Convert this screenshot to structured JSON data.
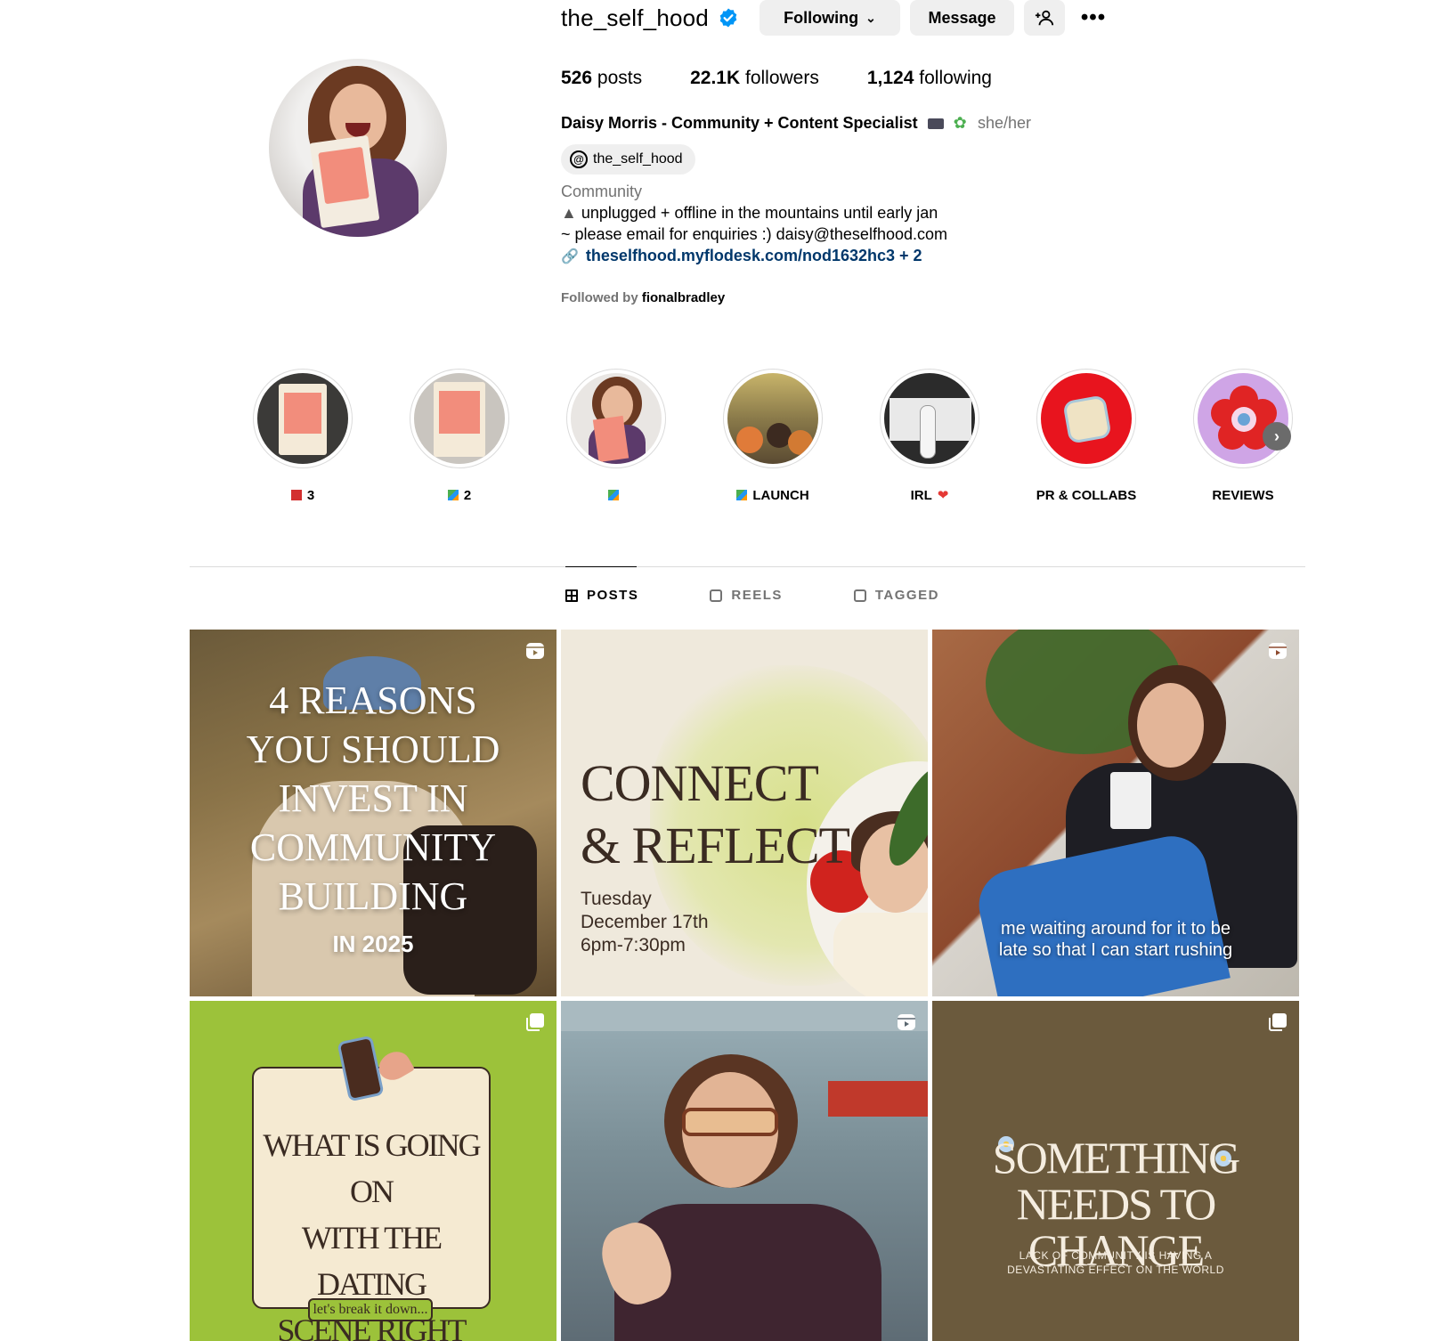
{
  "profile": {
    "username": "the_self_hood",
    "following_label": "Following",
    "message_label": "Message",
    "more_label": "•••",
    "stats": {
      "posts_count": "526",
      "posts_label": "posts",
      "followers_count": "22.1K",
      "followers_label": "followers",
      "following_count": "1,124",
      "following_label": "following"
    },
    "full_name": "Daisy Morris - Community + Content Specialist",
    "pronouns": "she/her",
    "threads_handle": "the_self_hood",
    "category": "Community",
    "bio_line1": "unplugged + offline in the mountains until early jan",
    "bio_line2": "~ please email for enquiries :) daisy@theselfhood.com",
    "link": "theselfhood.myflodesk.com/nod1632hc3 + 2",
    "followed_by_prefix": "Followed by",
    "followed_by_user": "fionalbradley"
  },
  "highlights": [
    {
      "label": "3",
      "badge": "red-book"
    },
    {
      "label": "2",
      "badge": "multi-book"
    },
    {
      "label": "",
      "badge": "multi-book"
    },
    {
      "label": "LAUNCH",
      "badge": "multi-book"
    },
    {
      "label": "IRL",
      "badge": "heart"
    },
    {
      "label": "PR & COLLABS",
      "badge": ""
    },
    {
      "label": "REVIEWS",
      "badge": ""
    }
  ],
  "tabs": [
    {
      "label": "POSTS",
      "active": true,
      "icon": "grid-icon"
    },
    {
      "label": "REELS",
      "active": false,
      "icon": "reels-icon"
    },
    {
      "label": "TAGGED",
      "active": false,
      "icon": "tagged-icon"
    }
  ],
  "posts": [
    {
      "type": "reel",
      "title_lines": [
        "4 REASONS",
        "YOU SHOULD",
        "INVEST IN",
        "COMMUNITY",
        "BUILDING"
      ],
      "subtitle": "IN 2025"
    },
    {
      "type": "image",
      "title_lines": [
        "CONNECT",
        "& REFLECT"
      ],
      "when_lines": [
        "Tuesday",
        "December 17th",
        "6pm-7:30pm"
      ]
    },
    {
      "type": "reel",
      "caption_lines": [
        "me waiting around for it to be",
        "late so that I can start rushing"
      ]
    },
    {
      "type": "carousel",
      "title_lines": [
        "WHAT IS GOING ON",
        "WITH THE DATING",
        "SCENE RIGHT NOW?"
      ],
      "pill": "let's break it down..."
    },
    {
      "type": "reel"
    },
    {
      "type": "carousel",
      "title_lines": [
        "SOMETHING",
        "NEEDS TO CHANGE"
      ],
      "sub_lines": [
        "LACK OF COMMUNITY IS HAVING A",
        "DEVASTATING EFFECT ON THE WORLD"
      ]
    }
  ],
  "colors": {
    "verified": "#0095f6",
    "link": "#00376b",
    "button_bg": "#efefef",
    "muted_text": "#737373"
  }
}
